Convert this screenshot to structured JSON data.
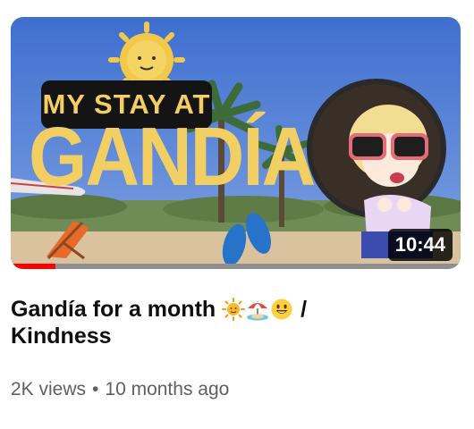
{
  "video": {
    "thumbnail": {
      "overlay_top_text": "MY STAY AT",
      "overlay_title_text": "GANDÍA",
      "duration": "10:44",
      "watch_progress": 0.1,
      "progress_color": "#ff0000"
    },
    "title_line1": "Gandía for a month",
    "title_suffix": "/",
    "title_line2": "Kindness",
    "title_emojis": [
      "sun-emoji",
      "beach-umbrella-emoji",
      "smiley-emoji"
    ],
    "views": "2K views",
    "separator": "•",
    "age": "10 months ago"
  }
}
